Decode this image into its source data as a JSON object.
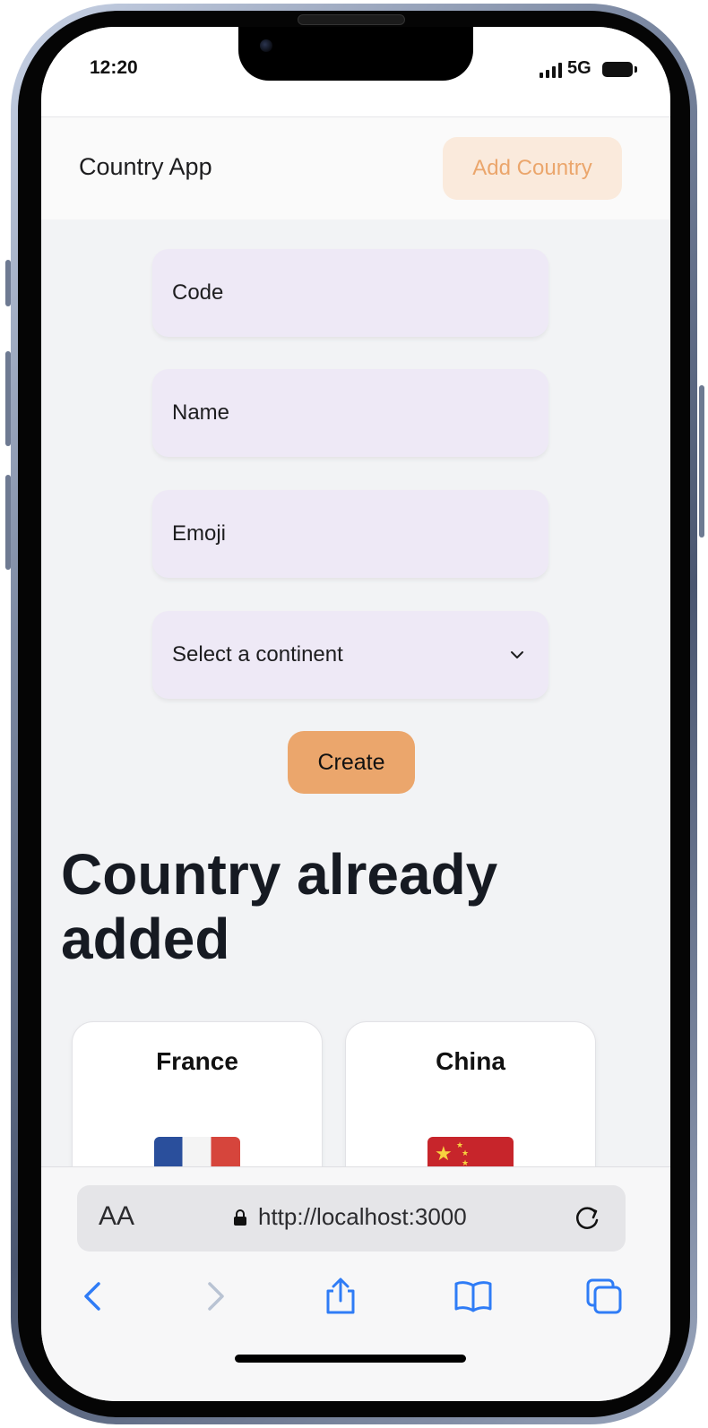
{
  "status_bar": {
    "time": "12:20",
    "network": "5G"
  },
  "navbar": {
    "title": "Country App",
    "add_button": "Add Country"
  },
  "form": {
    "code_placeholder": "Code",
    "name_placeholder": "Name",
    "emoji_placeholder": "Emoji",
    "continent_selected": "Select a continent",
    "create_button": "Create"
  },
  "section": {
    "heading": "Country already added"
  },
  "countries": [
    {
      "name": "France",
      "flag": "flag-france-icon"
    },
    {
      "name": "China",
      "flag": "flag-china-icon"
    }
  ],
  "browser": {
    "aa_label": "AA",
    "url": "http://localhost:3000"
  },
  "colors": {
    "accent": "#eba66c",
    "accent_light": "#faeadc",
    "input_bg": "#eee9f6",
    "page_bg": "#f2f3f5",
    "ios_blue": "#2f7cf6"
  }
}
